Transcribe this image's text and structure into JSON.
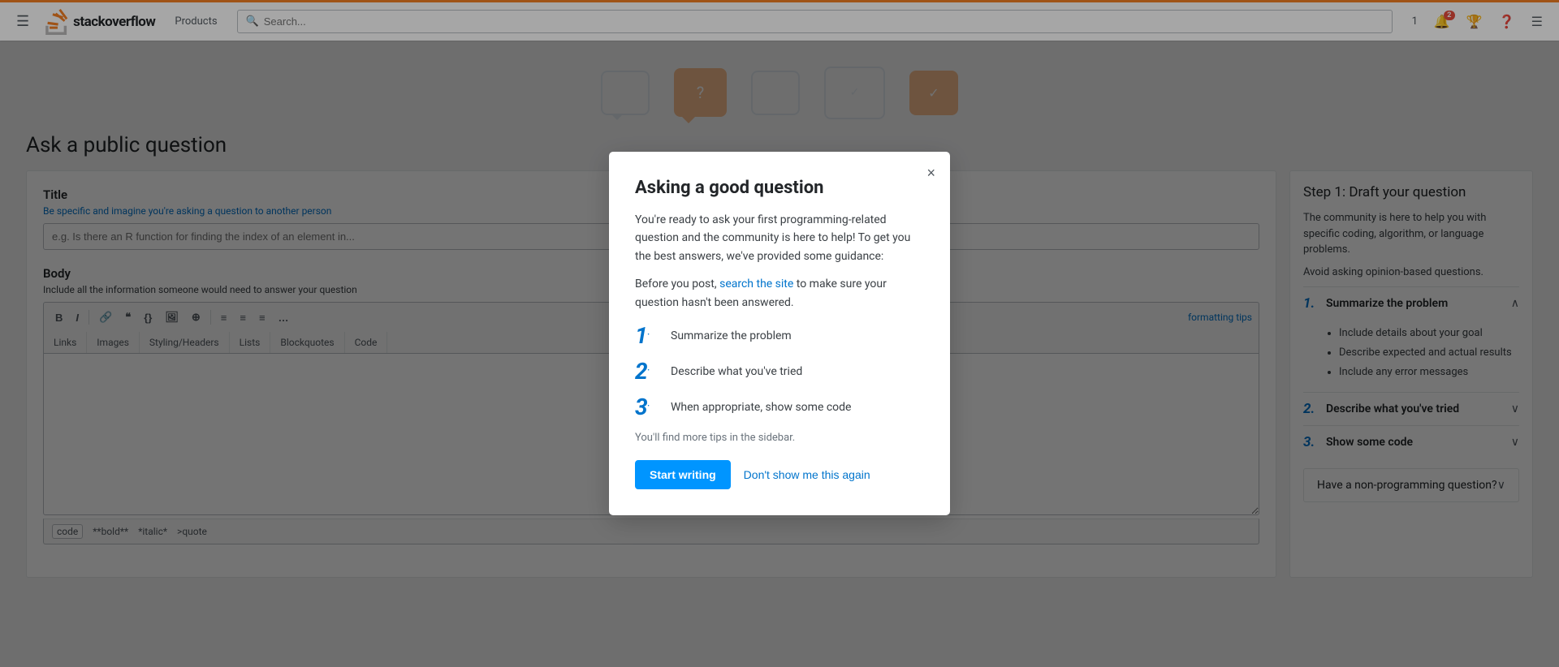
{
  "header": {
    "logo_text_light": "stack",
    "logo_text_bold": "overflow",
    "products_label": "Products",
    "search_placeholder": "Search...",
    "notification_count": "2",
    "inbox_count": "1"
  },
  "page": {
    "title": "Ask a public question"
  },
  "form": {
    "title_label": "Title",
    "title_hint": "Be specific and imagine you're asking a question to another person",
    "title_placeholder": "e.g. Is there an R function for finding the index of an element in...",
    "body_label": "Body",
    "body_hint": "Include all the information someone would need to answer your question"
  },
  "toolbar": {
    "bold": "B",
    "italic": "I",
    "link": "🔗",
    "blockquote": "❝",
    "code_inline": "{}",
    "image": "🖼",
    "extra": "⚙",
    "ol": "≡",
    "ul": "≡",
    "align": "≡",
    "more": "…",
    "tips": "formatting tips"
  },
  "editor_tabs": [
    "Links",
    "Images",
    "Styling/Headers",
    "Lists",
    "Blockquotes",
    "Code"
  ],
  "editor_footer": {
    "code": "code",
    "bold": "**bold**",
    "italic": "*italic*",
    "quote": ">quote"
  },
  "sidebar": {
    "step_title": "Step 1: Draft your question",
    "step_desc1": "The community is here to help you with specific coding, algorithm, or language problems.",
    "step_desc2": "Avoid asking opinion-based questions.",
    "items": [
      {
        "num": "1.",
        "label": "Summarize the problem",
        "expanded": true,
        "bullets": [
          "Include details about your goal",
          "Describe expected and actual results",
          "Include any error messages"
        ]
      },
      {
        "num": "2.",
        "label": "Describe what you've tried",
        "expanded": false,
        "bullets": []
      },
      {
        "num": "3.",
        "label": "Show some code",
        "expanded": false,
        "bullets": []
      }
    ],
    "non_prog_label": "Have a non-programming question?"
  },
  "modal": {
    "title": "Asking a good question",
    "intro1": "You're ready to ask your first programming-related question and the community is here to help! To get you the best answers, we've provided some guidance:",
    "intro2_pre": "Before you post, ",
    "intro2_link": "search the site",
    "intro2_post": " to make sure your question hasn't been answered.",
    "steps": [
      {
        "num": "1.",
        "text": "Summarize the problem"
      },
      {
        "num": "2.",
        "text": "Describe what you've tried"
      },
      {
        "num": "3.",
        "text": "When appropriate, show some code"
      }
    ],
    "sidebar_tip": "You'll find more tips in the sidebar.",
    "start_writing": "Start writing",
    "dont_show": "Don't show me this again",
    "close_label": "×"
  }
}
